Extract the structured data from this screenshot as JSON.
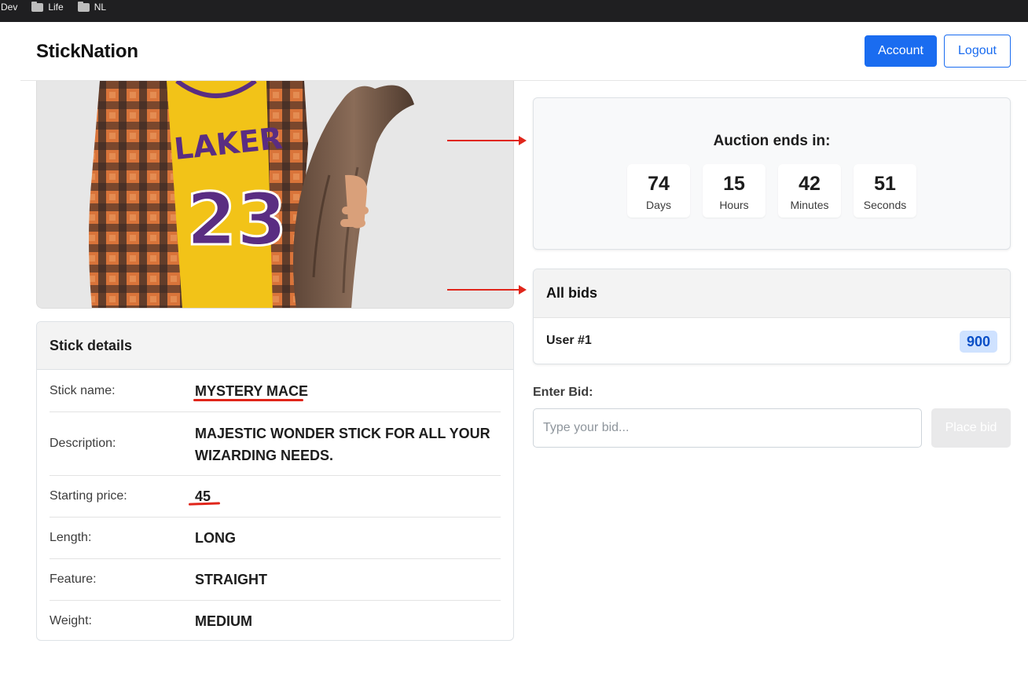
{
  "bookmarks": [
    {
      "label": "Dev",
      "icon": "none"
    },
    {
      "label": "Life",
      "icon": "folder-icon"
    },
    {
      "label": "NL",
      "icon": "folder-icon"
    }
  ],
  "navbar": {
    "brand": "StickNation",
    "account_label": "Account",
    "logout_label": "Logout"
  },
  "product": {
    "image_jersey_text": "LAKER",
    "image_jersey_number": "23"
  },
  "details": {
    "title": "Stick details",
    "rows": [
      {
        "label": "Stick name:",
        "value": "MYSTERY MACE"
      },
      {
        "label": "Description:",
        "value": "MAJESTIC WONDER STICK FOR ALL YOUR WIZARDING NEEDS."
      },
      {
        "label": "Starting price:",
        "value": "45"
      },
      {
        "label": "Length:",
        "value": "LONG"
      },
      {
        "label": "Feature:",
        "value": "STRAIGHT"
      },
      {
        "label": "Weight:",
        "value": "MEDIUM"
      }
    ]
  },
  "auction": {
    "title": "Auction ends in:",
    "countdown": [
      {
        "value": "74",
        "unit": "Days"
      },
      {
        "value": "15",
        "unit": "Hours"
      },
      {
        "value": "42",
        "unit": "Minutes"
      },
      {
        "value": "51",
        "unit": "Seconds"
      }
    ]
  },
  "bids": {
    "title": "All bids",
    "items": [
      {
        "user": "User #1",
        "amount": "900"
      }
    ]
  },
  "bid_form": {
    "label": "Enter Bid:",
    "placeholder": "Type your bid...",
    "button_label": "Place bid"
  },
  "colors": {
    "primary": "#1a6cf0",
    "annotation": "#e0261b",
    "bookmarks_bar": "#1f1f21",
    "bid_badge_bg": "#cfe2ff"
  }
}
